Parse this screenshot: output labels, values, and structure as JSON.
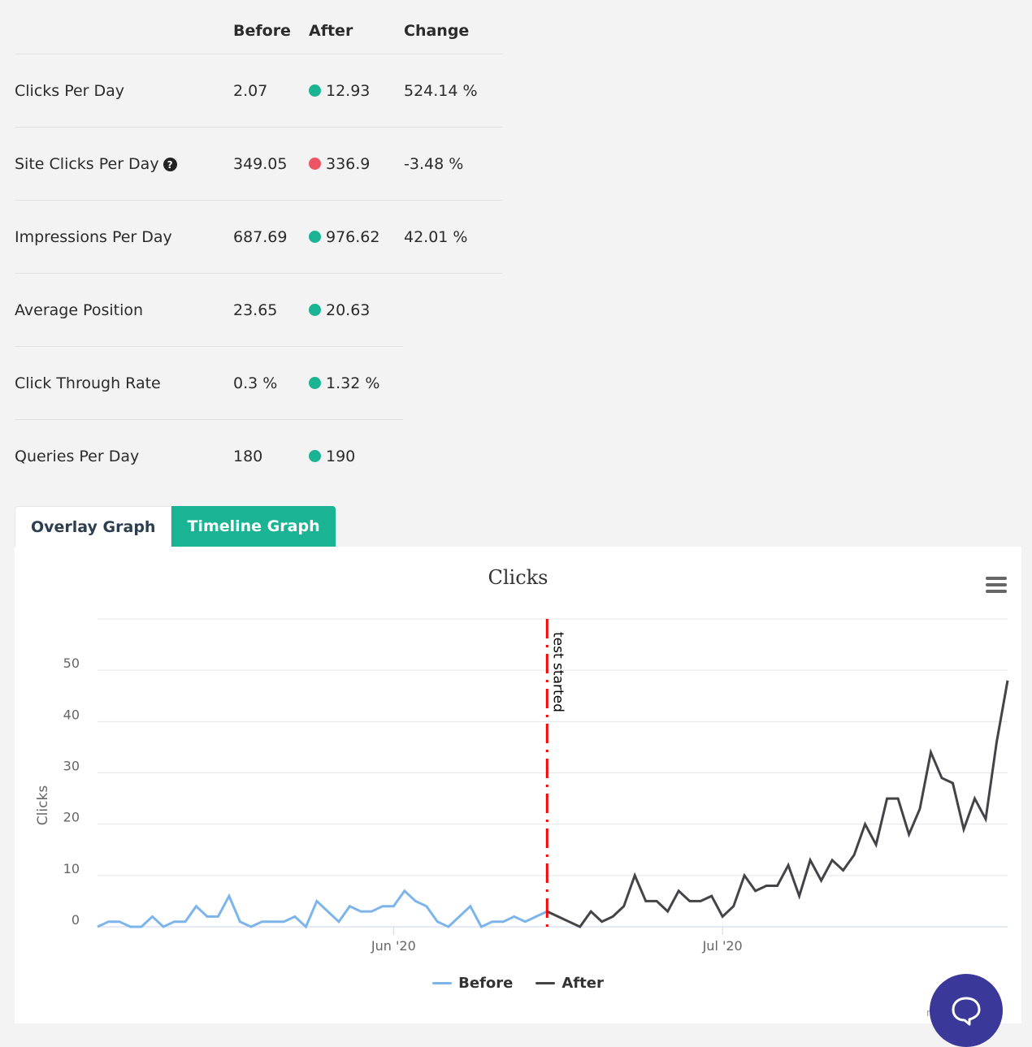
{
  "metrics_table": {
    "headers": {
      "label": "",
      "before": "Before",
      "after": "After",
      "change": "Change"
    },
    "rows": [
      {
        "label": "Clicks Per Day",
        "before": "2.07",
        "after": "12.93",
        "after_status": "good",
        "change": "524.14 %",
        "has_help": false
      },
      {
        "label": "Site Clicks Per Day",
        "before": "349.05",
        "after": "336.9",
        "after_status": "bad",
        "change": "-3.48 %",
        "has_help": true
      },
      {
        "label": "Impressions Per Day",
        "before": "687.69",
        "after": "976.62",
        "after_status": "good",
        "change": "42.01 %",
        "has_help": false
      },
      {
        "label": "Average Position",
        "before": "23.65",
        "after": "20.63",
        "after_status": "good",
        "change": "",
        "has_help": false
      },
      {
        "label": "Click Through Rate",
        "before": "0.3 %",
        "after": "1.32 %",
        "after_status": "good",
        "change": "",
        "has_help": false
      },
      {
        "label": "Queries Per Day",
        "before": "180",
        "after": "190",
        "after_status": "good",
        "change": "",
        "has_help": false
      }
    ],
    "help_icon": "question-circle-icon"
  },
  "colors": {
    "good": "#1ab394",
    "bad": "#ed5565",
    "tab_active": "#1ab394",
    "before_line": "#7cb5ec",
    "after_line": "#434348",
    "test_line": "#ff0000",
    "chat": "#3a3899"
  },
  "tabs": [
    {
      "label": "Overlay Graph",
      "active": false
    },
    {
      "label": "Timeline Graph",
      "active": true
    }
  ],
  "chart_menu_icon": "hamburger-menu-icon",
  "chat_icon": "speech-bubble-icon",
  "chart_data": {
    "type": "line",
    "title": "Clicks",
    "xlabel": "",
    "ylabel": "Clicks",
    "ylim": [
      0,
      60
    ],
    "yticks": [
      0,
      10,
      20,
      30,
      40,
      50
    ],
    "xticks": [
      {
        "label": "Jun '20",
        "index": 27
      },
      {
        "label": "Jul '20",
        "index": 57
      }
    ],
    "x_count": 84,
    "grid": true,
    "legend": "bottom-center",
    "plot_line": {
      "label": "test started",
      "index": 41
    },
    "series": [
      {
        "name": "Before",
        "start_index": 0,
        "values": [
          0,
          1,
          1,
          0,
          0,
          2,
          0,
          1,
          1,
          4,
          2,
          2,
          6,
          1,
          0,
          1,
          1,
          1,
          2,
          0,
          5,
          3,
          1,
          4,
          3,
          3,
          4,
          4,
          7,
          5,
          4,
          1,
          0,
          2,
          4,
          0,
          1,
          1,
          2,
          1,
          2,
          3
        ]
      },
      {
        "name": "After",
        "start_index": 41,
        "values": [
          3,
          2,
          1,
          0,
          3,
          1,
          2,
          4,
          10,
          5,
          5,
          3,
          7,
          5,
          5,
          6,
          2,
          4,
          10,
          7,
          8,
          8,
          12,
          6,
          13,
          9,
          13,
          11,
          14,
          20,
          16,
          25,
          25,
          18,
          23,
          34,
          29,
          28,
          19,
          25,
          21,
          36,
          48
        ]
      }
    ]
  },
  "credits_text": "m"
}
